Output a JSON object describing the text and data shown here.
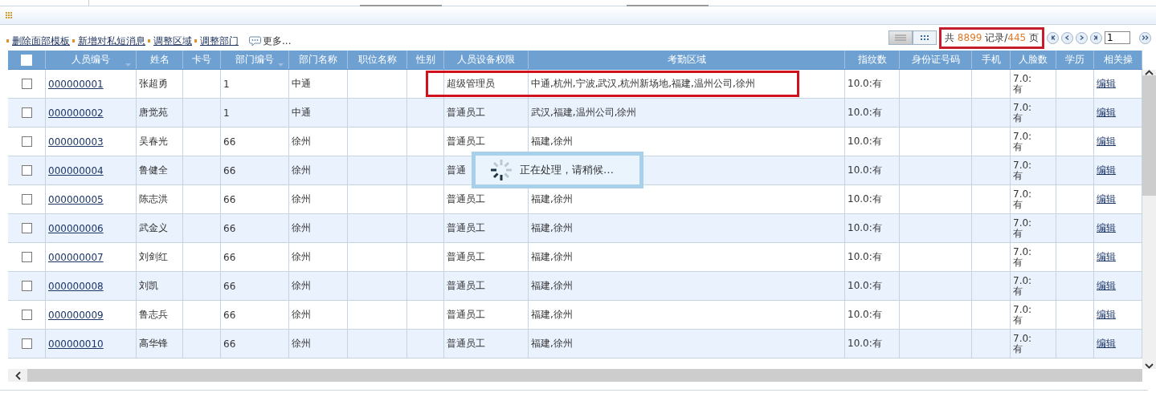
{
  "actions": [
    {
      "label": "删除面部模板"
    },
    {
      "label": "新增对私短消息"
    },
    {
      "label": "调整区域"
    },
    {
      "label": "调整部门"
    }
  ],
  "more": "更多...",
  "view_modes": [
    {
      "kind": "list",
      "selected": true
    },
    {
      "kind": "grid",
      "selected": false
    }
  ],
  "pager": {
    "prefix": "共",
    "records": "8899",
    "middle": "记录/",
    "pages": "445",
    "suffix": "页",
    "page": "1",
    "highlighted": true
  },
  "columns": [
    {
      "kind": "check",
      "checked": false
    },
    {
      "label": "人员编号",
      "sortable": true
    },
    {
      "label": "姓名",
      "sortable": false
    },
    {
      "label": "卡号",
      "sortable": false
    },
    {
      "label": "部门编号",
      "sortable": true
    },
    {
      "label": "部门名称",
      "sortable": false
    },
    {
      "label": "职位名称",
      "sortable": false
    },
    {
      "label": "性别",
      "sortable": false
    },
    {
      "label": "人员设备权限",
      "sortable": false
    },
    {
      "label": "考勤区域",
      "sortable": false
    },
    {
      "label": "指纹数",
      "sortable": false
    },
    {
      "label": "身份证号码",
      "sortable": false
    },
    {
      "label": "手机",
      "sortable": false
    },
    {
      "label": "人脸数",
      "sortable": false
    },
    {
      "label": "学历",
      "sortable": false
    },
    {
      "label": "相关操",
      "sortable": false
    }
  ],
  "rows": [
    {
      "checked": false,
      "highlighted": true,
      "cells": [
        "000000001",
        "张超勇",
        "",
        "1",
        "中通",
        "",
        "",
        "超级管理员",
        "中通,杭州,宁波,武汉,杭州新场地,福建,温州公司,徐州",
        "10.0:有",
        "",
        "",
        "7.0:有",
        "",
        "编辑"
      ]
    },
    {
      "checked": false,
      "highlighted": false,
      "cells": [
        "000000002",
        "唐觉苑",
        "",
        "1",
        "中通",
        "",
        "",
        "普通员工",
        "武汉,福建,温州公司,徐州",
        "10.0:有",
        "",
        "",
        "7.0:有",
        "",
        "编辑"
      ]
    },
    {
      "checked": false,
      "highlighted": false,
      "cells": [
        "000000003",
        "吴春光",
        "",
        "66",
        "徐州",
        "",
        "",
        "普通员工",
        "福建,徐州",
        "10.0:有",
        "",
        "",
        "7.0:有",
        "",
        "编辑"
      ]
    },
    {
      "checked": false,
      "highlighted": false,
      "cells": [
        "000000004",
        "鲁健全",
        "",
        "66",
        "徐州",
        "",
        "",
        "普通",
        "",
        "10.0:有",
        "",
        "",
        "7.0:有",
        "",
        "编辑"
      ]
    },
    {
      "checked": false,
      "highlighted": false,
      "cells": [
        "000000005",
        "陈志洪",
        "",
        "66",
        "徐州",
        "",
        "",
        "普通员工",
        "福建,徐州",
        "10.0:有",
        "",
        "",
        "7.0:有",
        "",
        "编辑"
      ]
    },
    {
      "checked": false,
      "highlighted": false,
      "cells": [
        "000000006",
        "武金义",
        "",
        "66",
        "徐州",
        "",
        "",
        "普通员工",
        "福建,徐州",
        "10.0:有",
        "",
        "",
        "7.0:有",
        "",
        "编辑"
      ]
    },
    {
      "checked": false,
      "highlighted": false,
      "cells": [
        "000000007",
        "刘剑红",
        "",
        "66",
        "徐州",
        "",
        "",
        "普通员工",
        "福建,徐州",
        "10.0:有",
        "",
        "",
        "7.0:有",
        "",
        "编辑"
      ]
    },
    {
      "checked": false,
      "highlighted": false,
      "cells": [
        "000000008",
        "刘凯",
        "",
        "66",
        "徐州",
        "",
        "",
        "普通员工",
        "福建,徐州",
        "10.0:有",
        "",
        "",
        "7.0:有",
        "",
        "编辑"
      ]
    },
    {
      "checked": false,
      "highlighted": false,
      "cells": [
        "000000009",
        "鲁志兵",
        "",
        "66",
        "徐州",
        "",
        "",
        "普通员工",
        "福建,徐州",
        "10.0:有",
        "",
        "",
        "7.0:有",
        "",
        "编辑"
      ]
    },
    {
      "checked": false,
      "highlighted": false,
      "cells": [
        "000000010",
        "高华锋",
        "",
        "66",
        "徐州",
        "",
        "",
        "普通员工",
        "福建,徐州",
        "10.0:有",
        "",
        "",
        "7.0:有",
        "",
        "编辑"
      ]
    }
  ],
  "busy": {
    "message": "正在处理，请稍候…"
  }
}
